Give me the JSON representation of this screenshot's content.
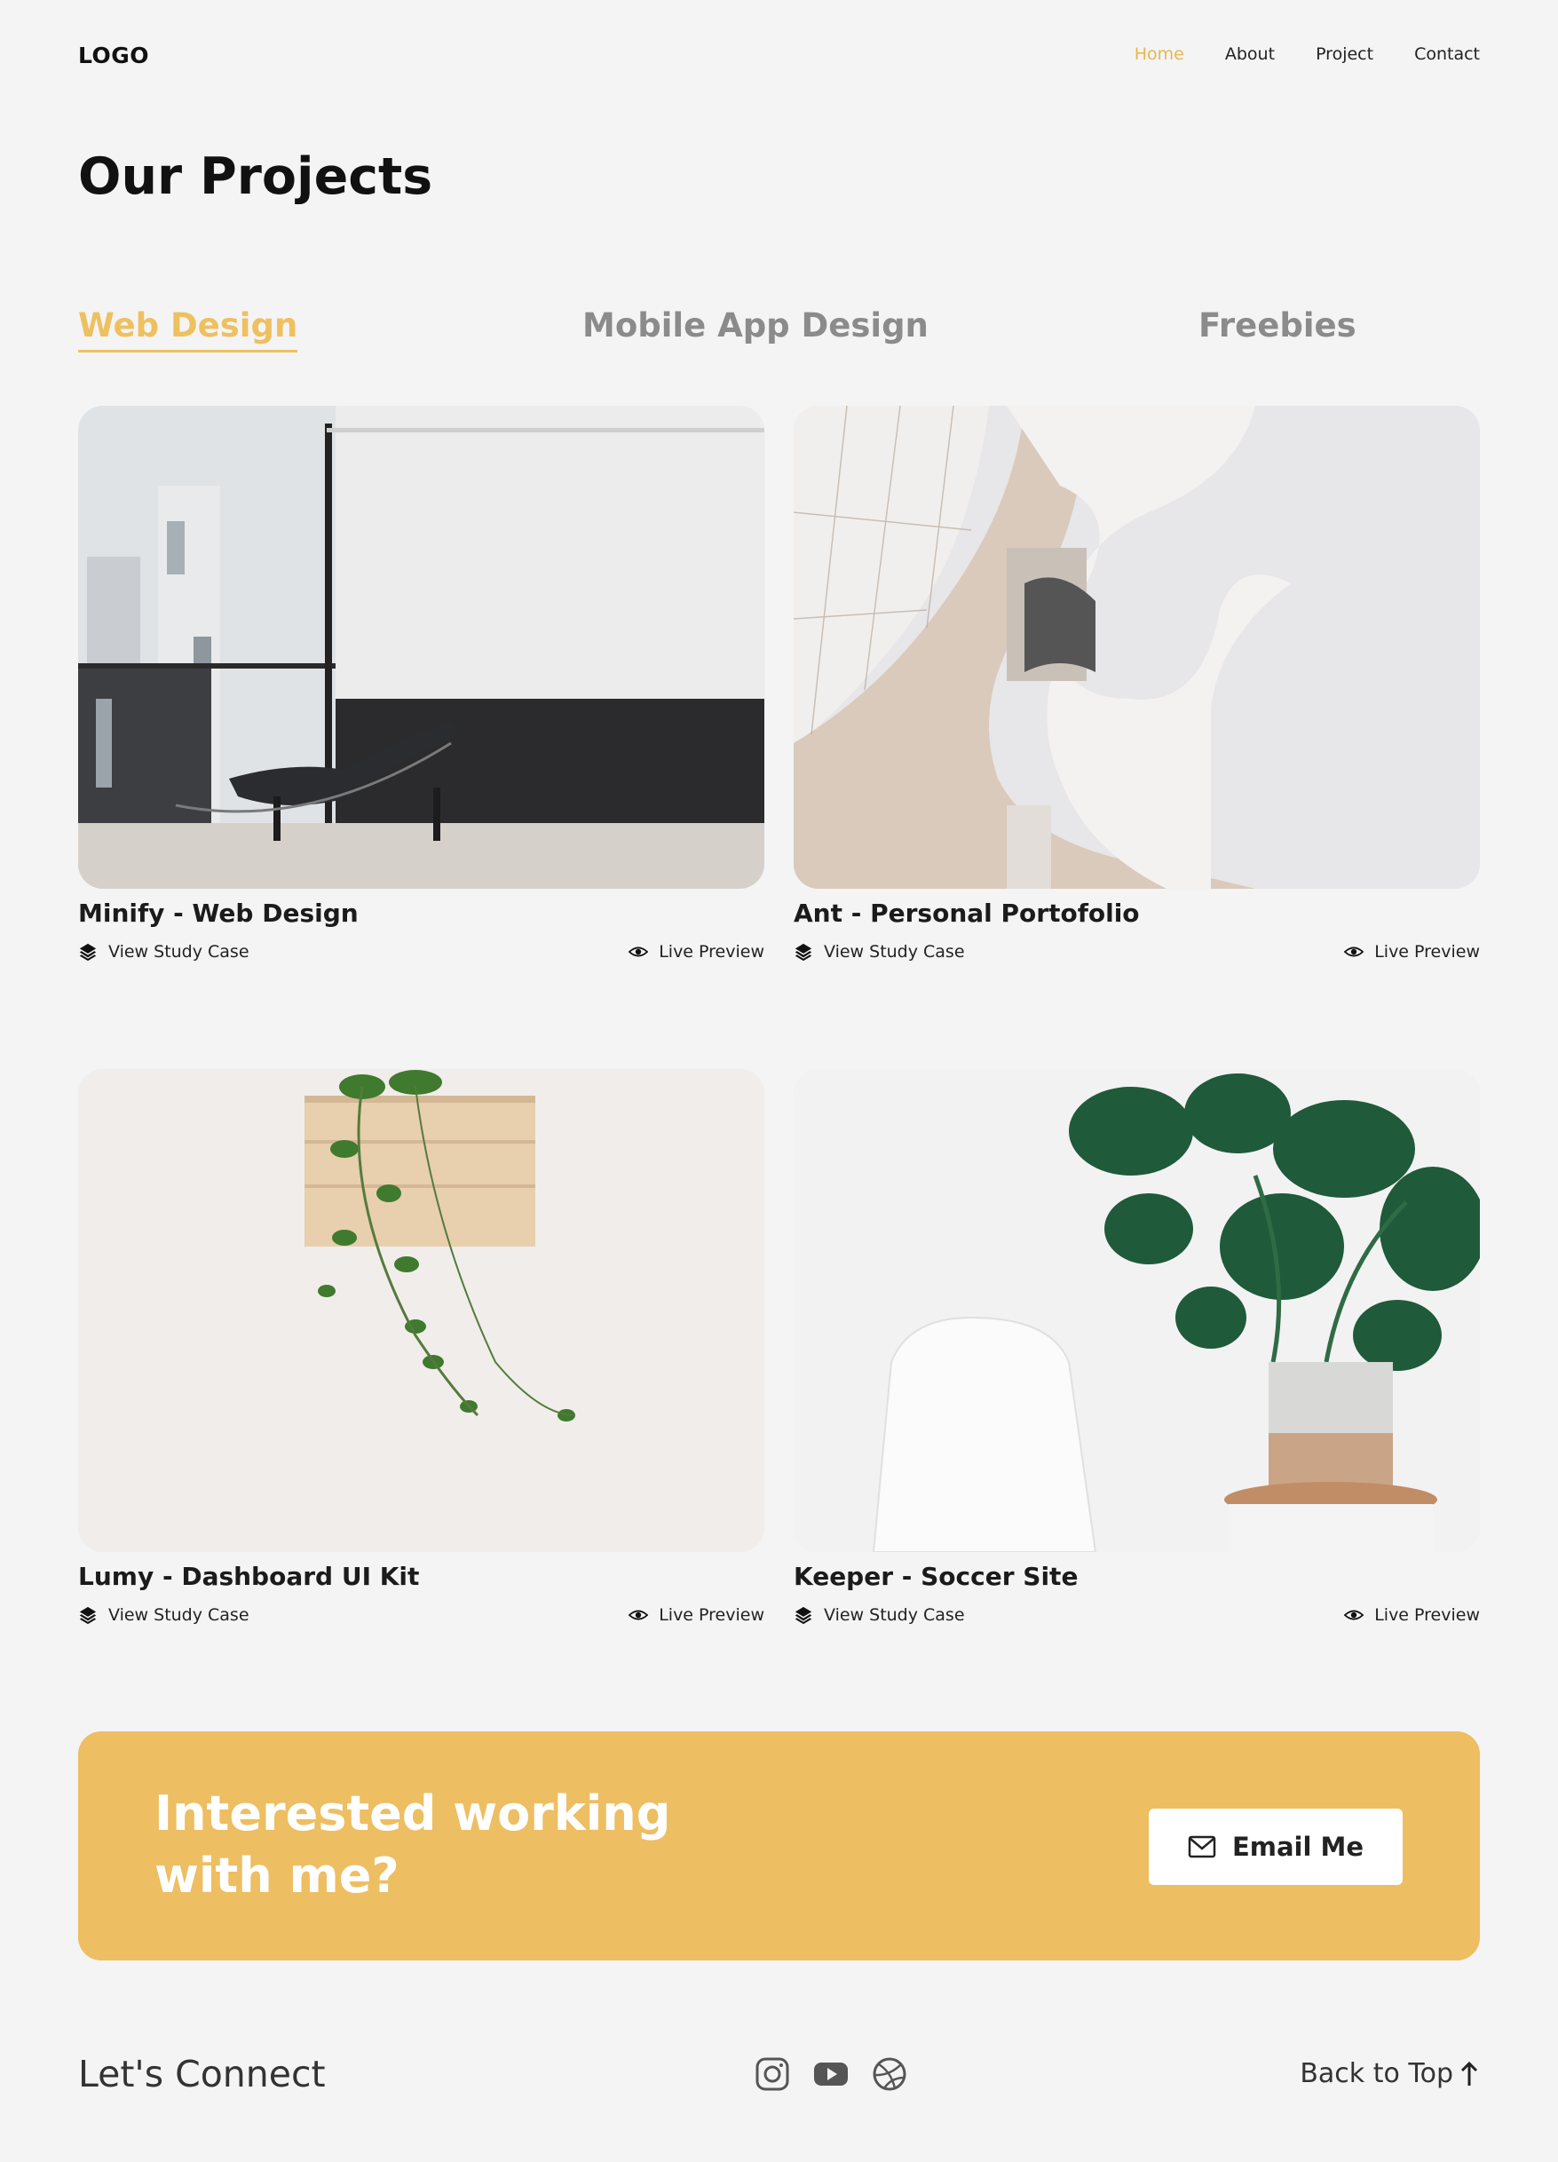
{
  "header": {
    "logo": "LOGO",
    "nav": [
      "Home",
      "About",
      "Project",
      "Contact"
    ],
    "active_nav": "Home"
  },
  "page": {
    "title": "Our Projects",
    "tabs": [
      "Web Design",
      "Mobile App Design",
      "Freebies"
    ],
    "active_tab": "Web Design"
  },
  "projects": [
    {
      "title": "Minify - Web Design",
      "study_case": "View Study Case",
      "preview": "Live Preview"
    },
    {
      "title": "Ant - Personal Portofolio",
      "study_case": "View Study Case",
      "preview": "Live Preview"
    },
    {
      "title": "Lumy - Dashboard UI Kit",
      "study_case": "View Study Case",
      "preview": "Live Preview"
    },
    {
      "title": "Keeper - Soccer Site",
      "study_case": "View Study Case",
      "preview": "Live Preview"
    }
  ],
  "cta": {
    "text": "Interested working with me?",
    "button": "Email Me"
  },
  "footer": {
    "connect": "Let's Connect",
    "social_icons": [
      "instagram-icon",
      "youtube-icon",
      "dribbble-icon"
    ],
    "back_to_top": "Back to Top"
  },
  "colors": {
    "accent": "#edbe62",
    "background": "#f4f4f4",
    "text": "#111111"
  }
}
